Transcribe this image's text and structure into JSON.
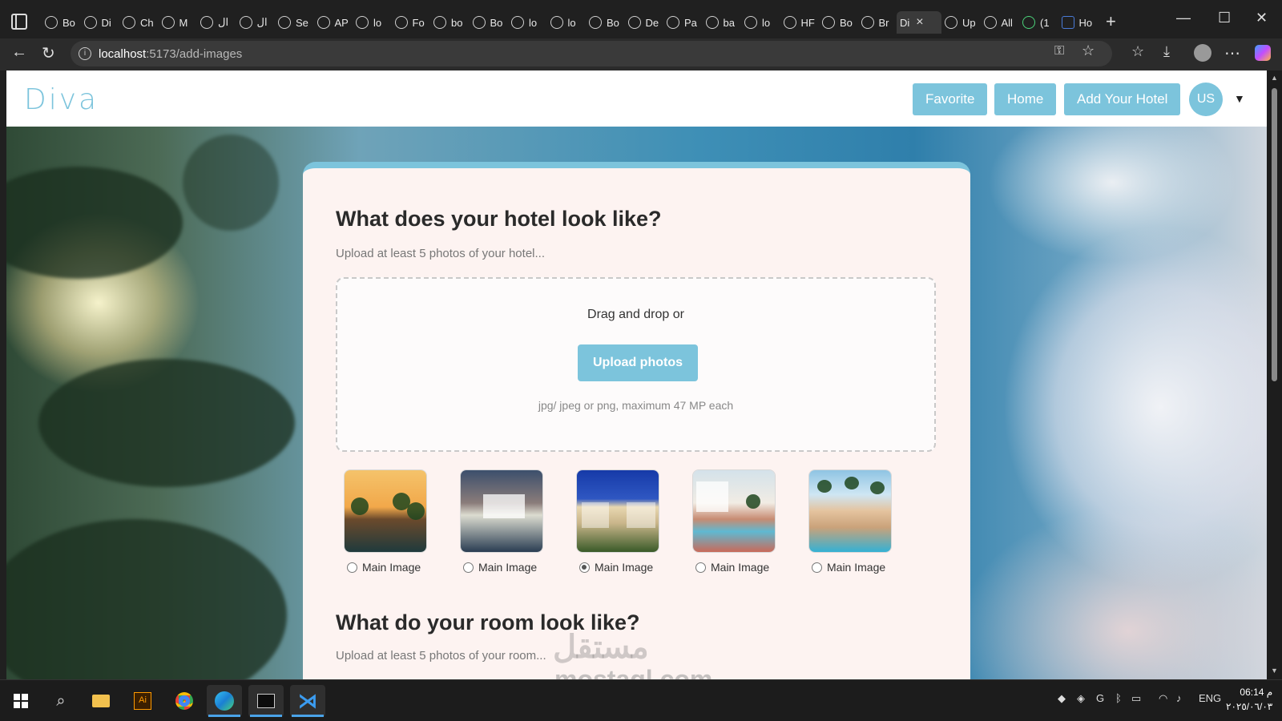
{
  "browser": {
    "tabs": [
      {
        "icon": "github-icon",
        "label": "Bo"
      },
      {
        "icon": "globe-icon",
        "label": "Di"
      },
      {
        "icon": "app-icon",
        "label": "Ch"
      },
      {
        "icon": "globe-icon",
        "label": "M"
      },
      {
        "icon": "app-icon",
        "label": "ال"
      },
      {
        "icon": "globe-icon",
        "label": "ال"
      },
      {
        "icon": "globe-icon",
        "label": "Se"
      },
      {
        "icon": "globe-icon",
        "label": "AP"
      },
      {
        "icon": "page-icon",
        "label": "lo"
      },
      {
        "icon": "globe-icon",
        "label": "Fo"
      },
      {
        "icon": "search-icon",
        "label": "bo"
      },
      {
        "icon": "globe-icon",
        "label": "Bo"
      },
      {
        "icon": "page-icon",
        "label": "lo"
      },
      {
        "icon": "page-icon",
        "label": "lo"
      },
      {
        "icon": "github-icon",
        "label": "Bo"
      },
      {
        "icon": "github-icon",
        "label": "De"
      },
      {
        "icon": "github-icon",
        "label": "Pa"
      },
      {
        "icon": "app-icon",
        "label": "ba"
      },
      {
        "icon": "page-icon",
        "label": "lo"
      },
      {
        "icon": "app-icon",
        "label": "HF"
      },
      {
        "icon": "globe-icon",
        "label": "Bo"
      },
      {
        "icon": "app-icon",
        "label": "Br"
      }
    ],
    "active_tab": {
      "label": "Di"
    },
    "tabs_after": [
      {
        "icon": "globe-icon",
        "label": "Up"
      },
      {
        "icon": "globe-icon",
        "label": "All"
      },
      {
        "icon": "whatsapp-icon",
        "label": "(1"
      },
      {
        "icon": "app-icon",
        "label": "Ho"
      }
    ],
    "url_host": "localhost",
    "url_path": ":5173/add-images"
  },
  "app": {
    "logo": "Diva",
    "nav": {
      "favorite": "Favorite",
      "home": "Home",
      "add_hotel": "Add Your Hotel",
      "avatar": "US"
    },
    "accent_color": "#7cc4dc"
  },
  "hotel_section": {
    "title": "What does your hotel look like?",
    "subtitle": "Upload at least 5 photos of your hotel...",
    "dropzone_text": "Drag and drop or",
    "upload_button": "Upload photos",
    "hint": "jpg/ jpeg or png, maximum 47 MP each",
    "images": [
      {
        "radio_label": "Main Image",
        "selected": false
      },
      {
        "radio_label": "Main Image",
        "selected": false
      },
      {
        "radio_label": "Main Image",
        "selected": true
      },
      {
        "radio_label": "Main Image",
        "selected": false
      },
      {
        "radio_label": "Main Image",
        "selected": false
      }
    ]
  },
  "room_section": {
    "title": "What do your room look like?",
    "subtitle": "Upload at least 5 photos of your room..."
  },
  "watermark": {
    "arabic": "مستقل",
    "latin": "mostaql.com"
  },
  "taskbar": {
    "language": "ENG",
    "time": "06:14 م",
    "date": "٢٠٢٥/٠٦/٠٣"
  }
}
